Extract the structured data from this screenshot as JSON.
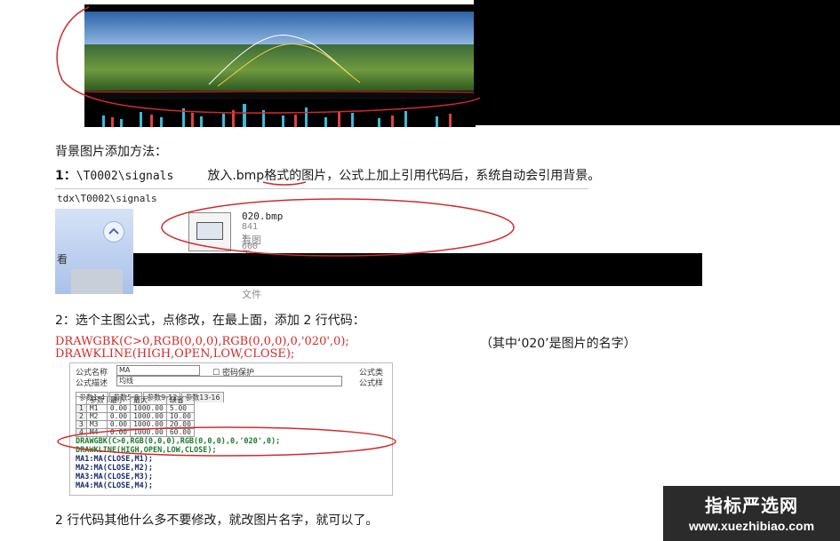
{
  "chart_screenshot": {
    "info_bar_text": "",
    "colors": {
      "sky": "#2d63a8",
      "hills": "#4f7f36",
      "annotation": "#d22a2a"
    }
  },
  "section_heading": "背景图片添加方法：",
  "step1": {
    "number": "1：",
    "path": "\\T0002\\signals",
    "instruction": "放入.bmp格式的图片，公式上加上引用代码后，系统自动会引用背景。"
  },
  "explorer": {
    "address": "tdx\\T0002\\signals",
    "left_pane_label": "看",
    "file_name": "020.bmp",
    "file_size": "841 x 600",
    "file_type": "看图王 BMP 图片文件"
  },
  "step2": {
    "text": "2：选个主图公式，点修改，在最上面，添加 2 行代码：",
    "code_line1": "DRAWGBK(C>0,RGB(0,0,0),RGB(0,0,0),0,'020',0);",
    "code_line2": "DRAWKLINE(HIGH,OPEN,LOW,CLOSE);",
    "note": "（其中‘020’是图片的名字）"
  },
  "editor": {
    "name_label": "公式名称",
    "name_value": "MA",
    "password_label": "密码保护",
    "desc_label": "公式描述",
    "desc_value": "均线",
    "right_label_1": "公式类",
    "right_label_2": "公式样",
    "tabs": [
      "参数1-4",
      "参数5-8",
      "参数9-12",
      "参数13-16"
    ],
    "table_headers": [
      "参数",
      "最小",
      "最大",
      "缺省"
    ],
    "table_rows": [
      [
        "1",
        "M1",
        "0.00",
        "1000.00",
        "5.00"
      ],
      [
        "2",
        "M2",
        "0.00",
        "1000.00",
        "10.00"
      ],
      [
        "3",
        "M3",
        "0.00",
        "1000.00",
        "20.00"
      ],
      [
        "4",
        "M4",
        "0.00",
        "1000.00",
        "60.00"
      ]
    ],
    "code_lines": [
      "DRAWGBK(C>0,RGB(0,0,0),RGB(0,0,0),0,'020',0);",
      "DRAWKLINE(HIGH,OPEN,LOW,CLOSE);",
      "MA1:MA(CLOSE,M1);",
      "MA2:MA(CLOSE,M2);",
      "MA3:MA(CLOSE,M3);",
      "MA4:MA(CLOSE,M4);"
    ]
  },
  "footer_text": "2 行代码其他什么多不要修改，就改图片名字，就可以了。",
  "watermark": {
    "title": "指标严选网",
    "url": "www.xuezhibiao.com"
  }
}
